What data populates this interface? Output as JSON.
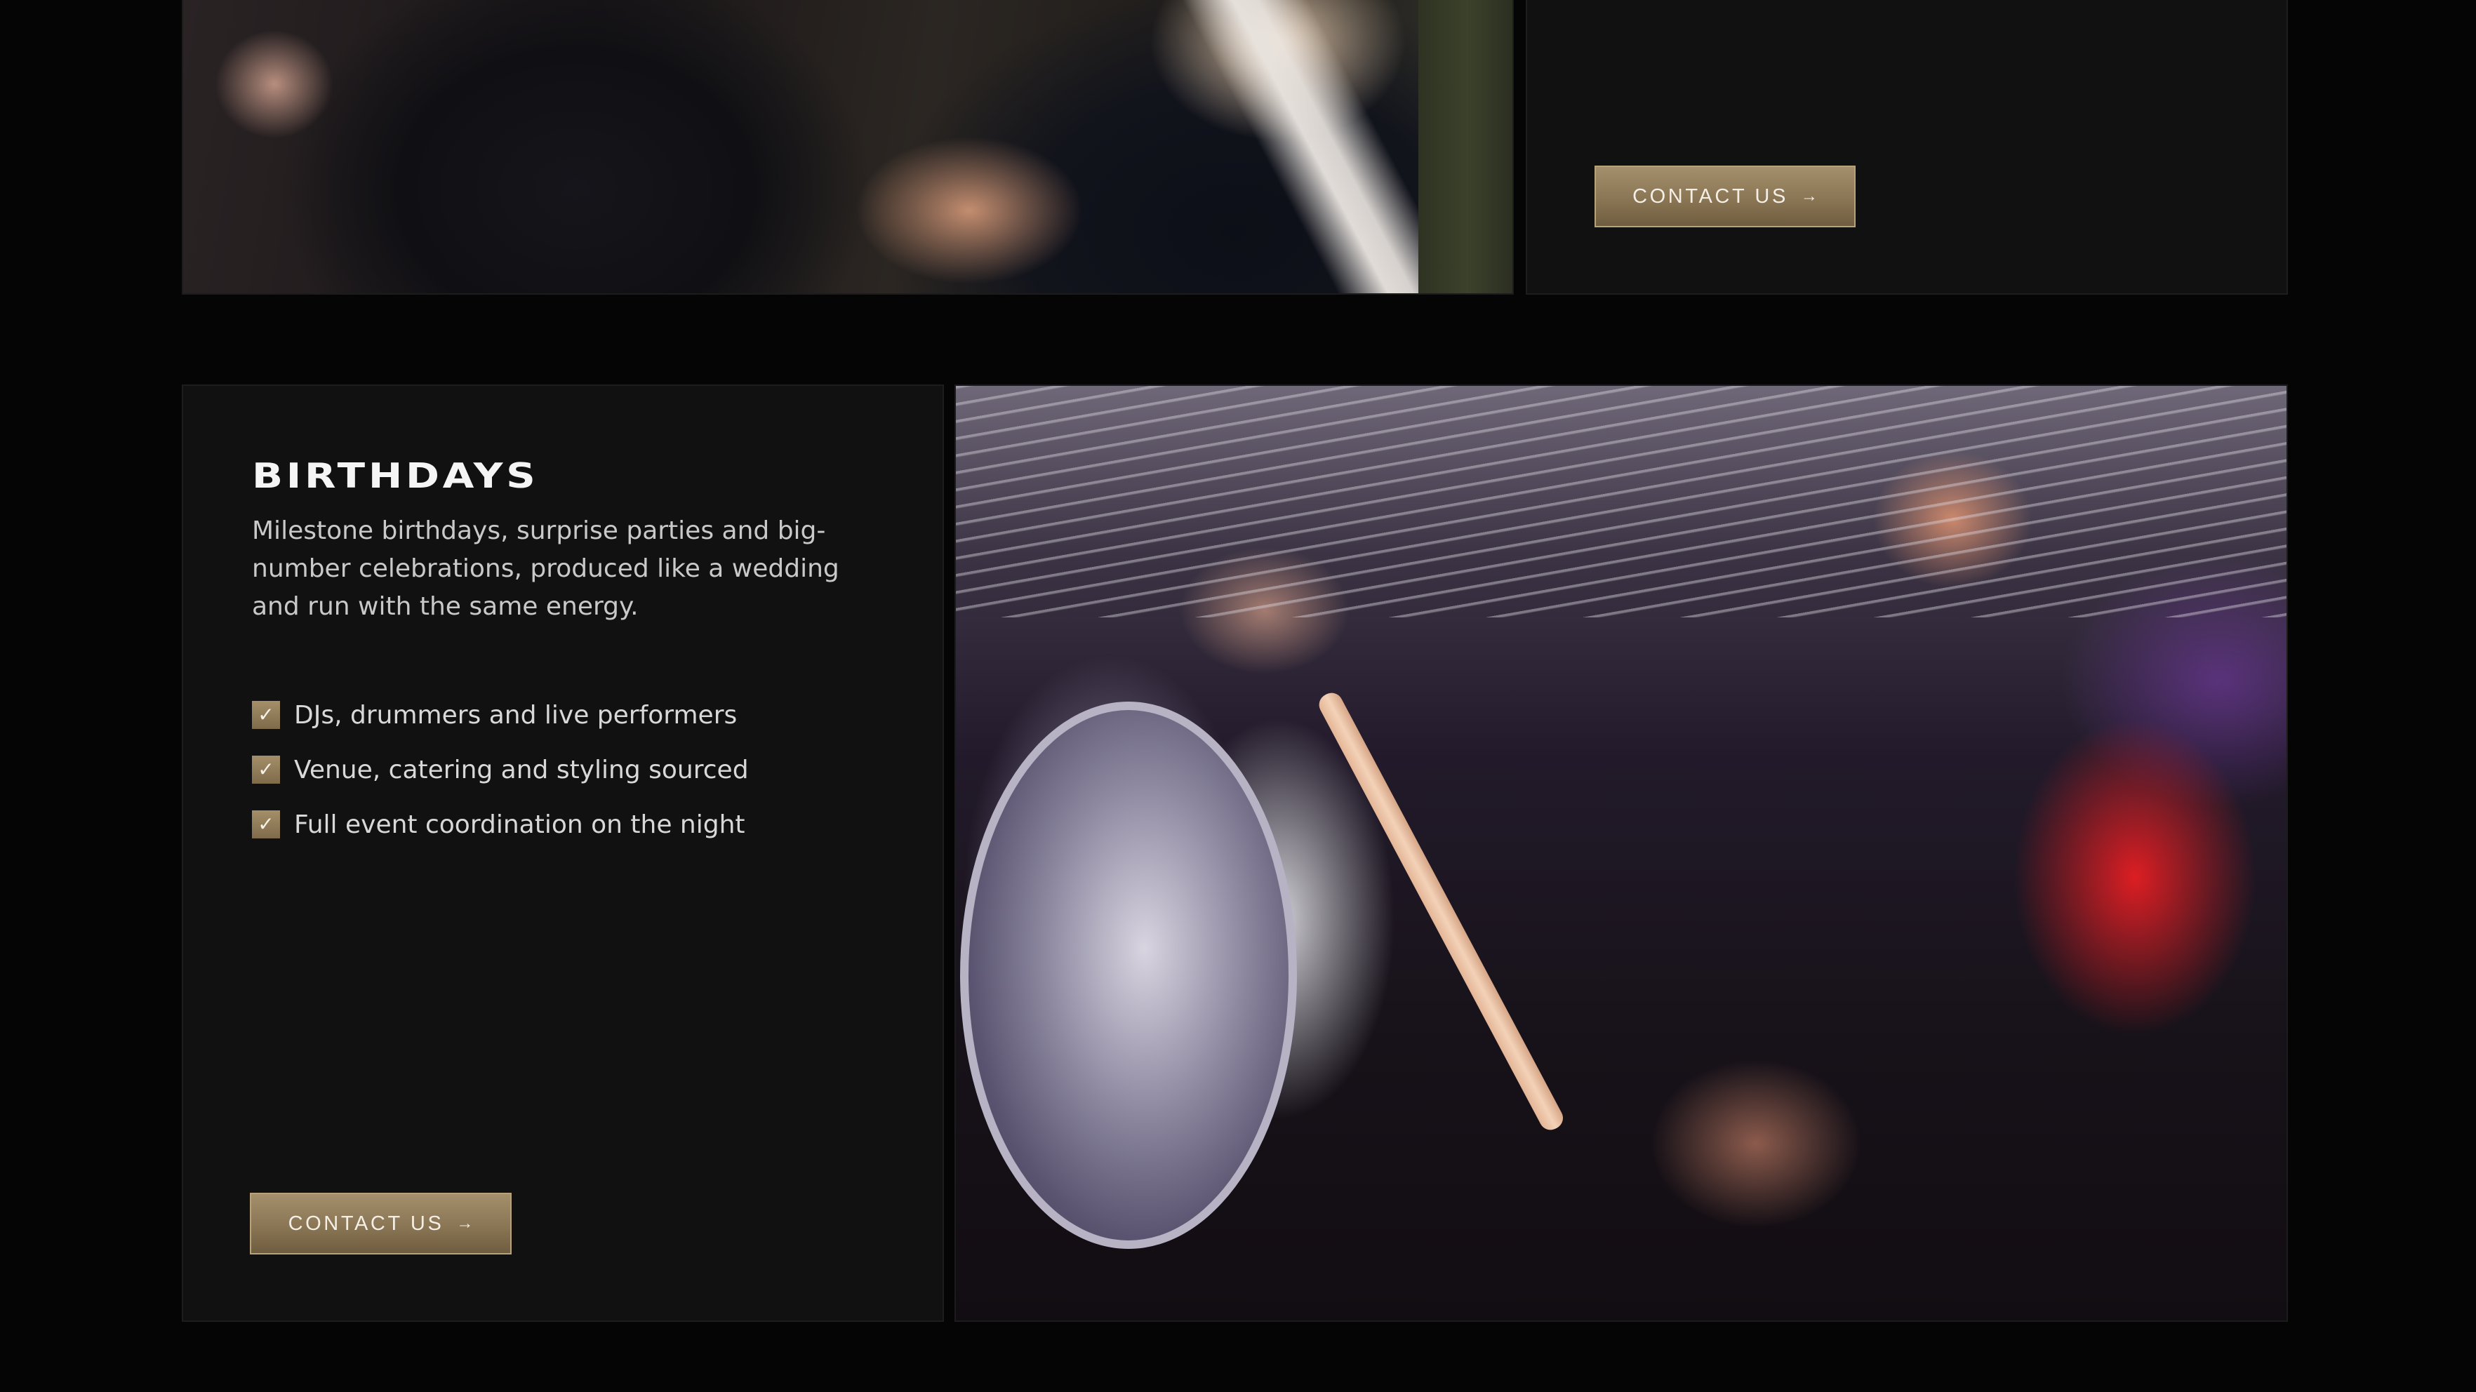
{
  "top_section": {
    "cta_label": "CONTACT US",
    "cta_arrow": "→"
  },
  "birthdays": {
    "title": "BIRTHDAYS",
    "description": "Milestone birthdays, surprise parties and big-number celebrations, produced like a wedding and run with the same energy.",
    "features": [
      {
        "text": "DJs, drummers and live performers",
        "icon": "check-icon"
      },
      {
        "text": "Venue, catering and styling sourced",
        "icon": "check-icon"
      },
      {
        "text": "Full event coordination on the night",
        "icon": "check-icon"
      }
    ],
    "cta_label": "CONTACT US",
    "cta_arrow": "→"
  },
  "colors": {
    "background": "#050505",
    "panel": "#111111",
    "accent_gold": "#8a7654",
    "text_primary": "#f5f5f5",
    "text_secondary": "#c9c9c9"
  }
}
